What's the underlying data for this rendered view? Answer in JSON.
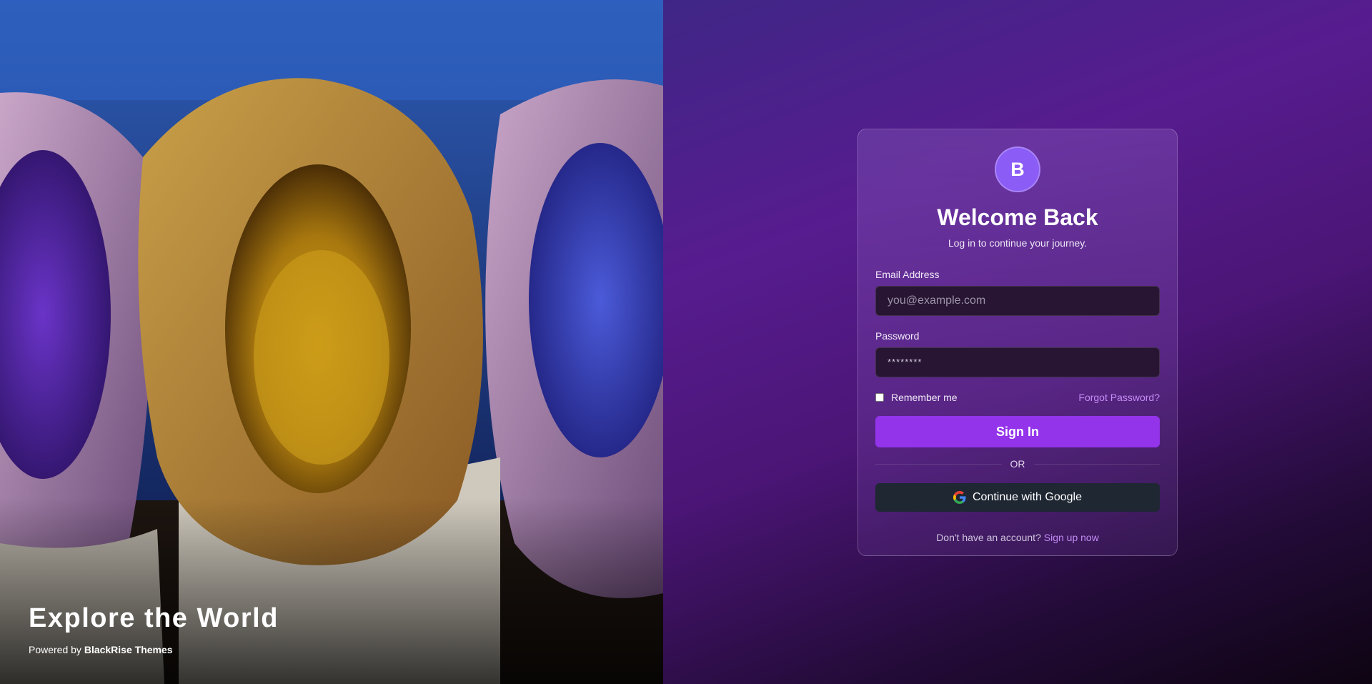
{
  "hero": {
    "title": "Explore the World",
    "credit_prefix": "Powered by",
    "credit_brand": "BlackRise Themes"
  },
  "card": {
    "logo_letter": "B",
    "title": "Welcome Back",
    "subtitle": "Log in to continue your journey.",
    "email_label": "Email Address",
    "email_placeholder": "you@example.com",
    "email_value": "",
    "password_label": "Password",
    "password_placeholder": "********",
    "password_value": "",
    "remember_label": "Remember me",
    "remember_checked": false,
    "forgot_label": "Forgot Password?",
    "signin_label": "Sign In",
    "divider_label": "OR",
    "google_label": "Continue with Google",
    "signup_prompt": "Don't have an account?",
    "signup_link": "Sign up now"
  },
  "colors": {
    "accent": "#9333ea",
    "logo": "#8b5cf6",
    "link": "#c38bf6",
    "input_bg": "#271533",
    "google_button_bg": "#1f2733"
  },
  "icons": {
    "logo": "brand-logo",
    "google": "google-icon"
  }
}
